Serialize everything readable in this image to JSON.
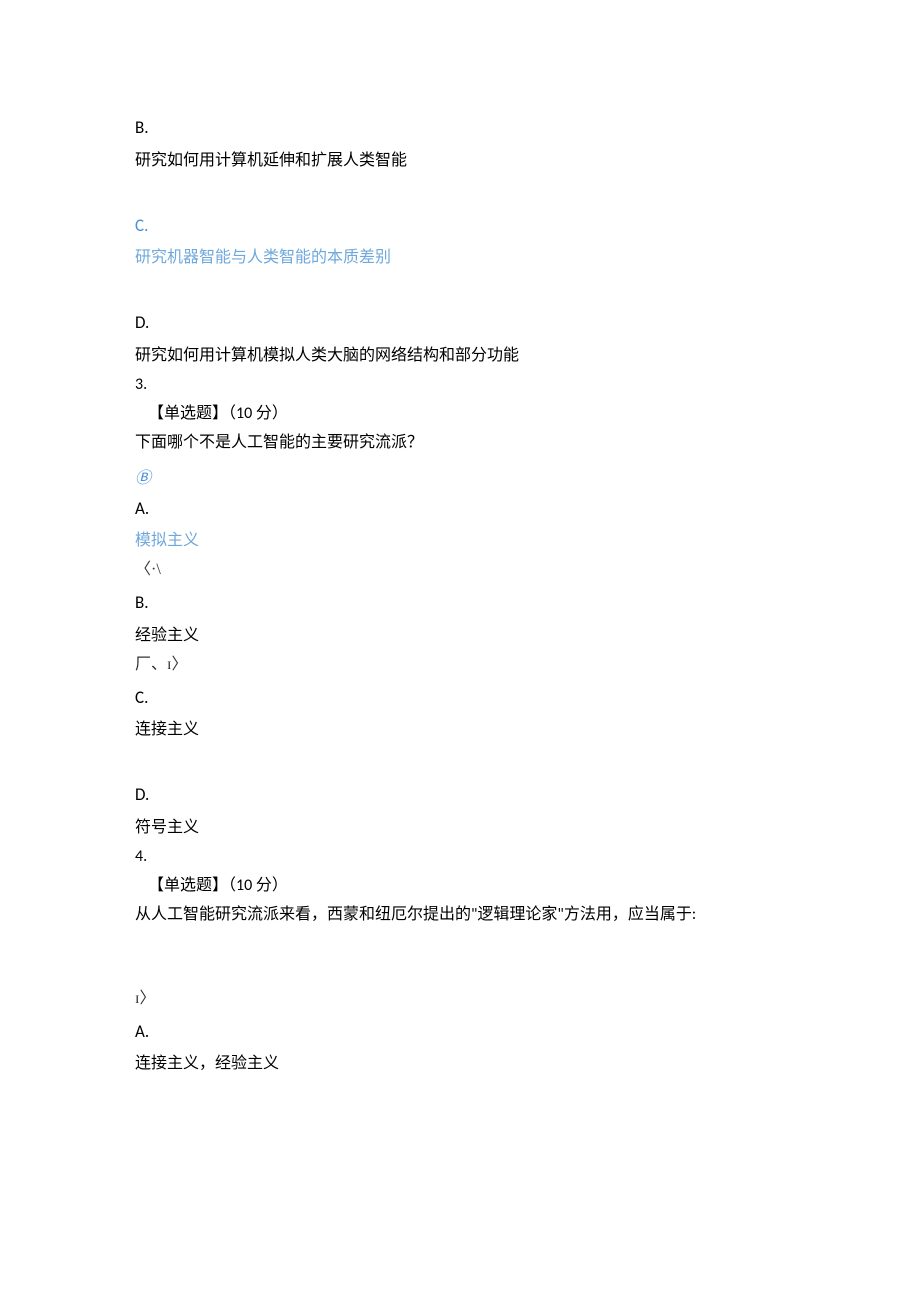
{
  "q2": {
    "optB": {
      "letter": "B.",
      "text": "研究如何用计算机延伸和扩展人类智能"
    },
    "optC": {
      "letter": "C.",
      "text": "研究机器智能与人类智能的本质差别"
    },
    "optD": {
      "letter": "D.",
      "text": "研究如何用计算机模拟人类大脑的网络结构和部分功能"
    }
  },
  "q3": {
    "number": "3.",
    "type": "【单选题】（",
    "points": "10",
    "pointsUnit": " 分）",
    "stem": "下面哪个不是人工智能的主要研究流派？",
    "correctMark": "Ⓑ",
    "optA": {
      "letter": "A.",
      "text": "模拟主义",
      "artifact": "〈·\\"
    },
    "optB": {
      "letter": "B.",
      "text": "经验主义",
      "artifact": "厂、ɪ〉"
    },
    "optC": {
      "letter": "C.",
      "text": "连接主义"
    },
    "optD": {
      "letter": "D.",
      "text": "符号主义"
    }
  },
  "q4": {
    "number": "4.",
    "type": "【单选题】（",
    "points": "10",
    "pointsUnit": " 分）",
    "stem": "从人工智能研究流派来看，西蒙和纽厄尔提出的\"逻辑理论家\"方法用，应当属于:",
    "artifact": "ɪ〉",
    "optA": {
      "letter": "A.",
      "text": "连接主义，经验主义"
    }
  }
}
